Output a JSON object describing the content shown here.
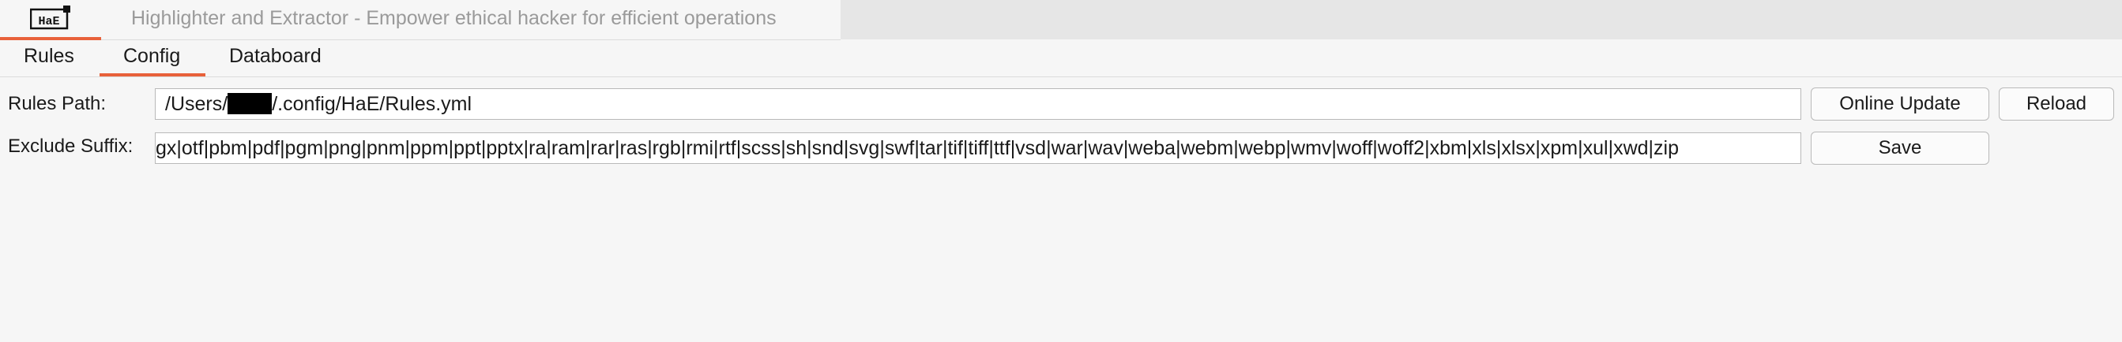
{
  "header": {
    "title": "Highlighter and Extractor - Empower ethical hacker for efficient operations",
    "logo_text": "HaE"
  },
  "tabs": [
    {
      "label": "Rules",
      "active": false
    },
    {
      "label": "Config",
      "active": true
    },
    {
      "label": "Databoard",
      "active": false
    }
  ],
  "config": {
    "rules_path_label": "Rules Path:",
    "rules_path_prefix": "/Users/",
    "rules_path_suffix": "/.config/HaE/Rules.yml",
    "exclude_suffix_label": "Exclude Suffix:",
    "exclude_suffix_value": "gx|otf|pbm|pdf|pgm|png|pnm|ppm|ppt|pptx|ra|ram|rar|ras|rgb|rmi|rtf|scss|sh|snd|svg|swf|tar|tif|tiff|ttf|vsd|war|wav|weba|webm|webp|wmv|woff|woff2|xbm|xls|xlsx|xpm|xul|xwd|zip"
  },
  "buttons": {
    "online_update": "Online Update",
    "reload": "Reload",
    "save": "Save"
  },
  "colors": {
    "accent": "#e8613a",
    "title_text": "#9a9a9a"
  }
}
